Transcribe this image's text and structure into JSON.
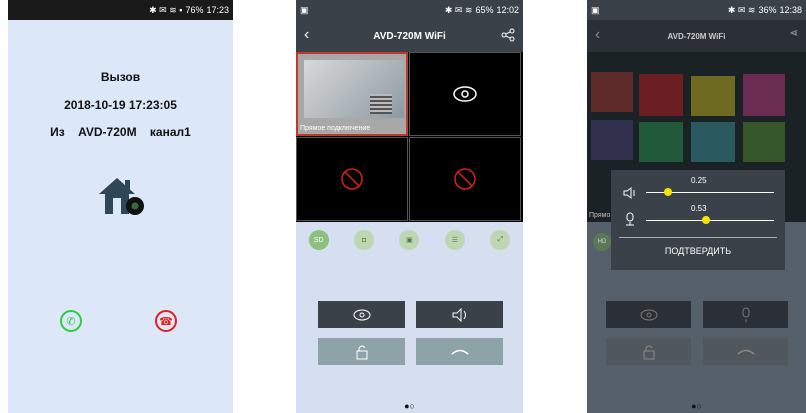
{
  "phone1": {
    "status": {
      "battery": "76%",
      "time": "17:23"
    },
    "title": "Вызов",
    "datetime": "2018-10-19  17:23:05",
    "from_prefix": "Из",
    "device": "AVD-720M",
    "channel": "канал1",
    "accept_color": "#2ecc40",
    "decline_color": "#e02020"
  },
  "phone2": {
    "status": {
      "battery": "65%",
      "time": "12:02"
    },
    "title": "AVD-720M WiFi",
    "cam_label": "Прямое подключение",
    "tools": [
      "SD",
      "camera-icon",
      "record-icon",
      "settings-icon",
      "fullscreen-icon"
    ],
    "tool_sd": "SD"
  },
  "phone3": {
    "status": {
      "battery": "36%",
      "time": "12:38"
    },
    "title": "AVD-720M WiFi",
    "cam_label": "Прямо",
    "speaker_level": "0.25",
    "mic_level": "0.53",
    "confirm": "ПОДТВЕРДИТЬ",
    "tool_hd": "HD"
  }
}
